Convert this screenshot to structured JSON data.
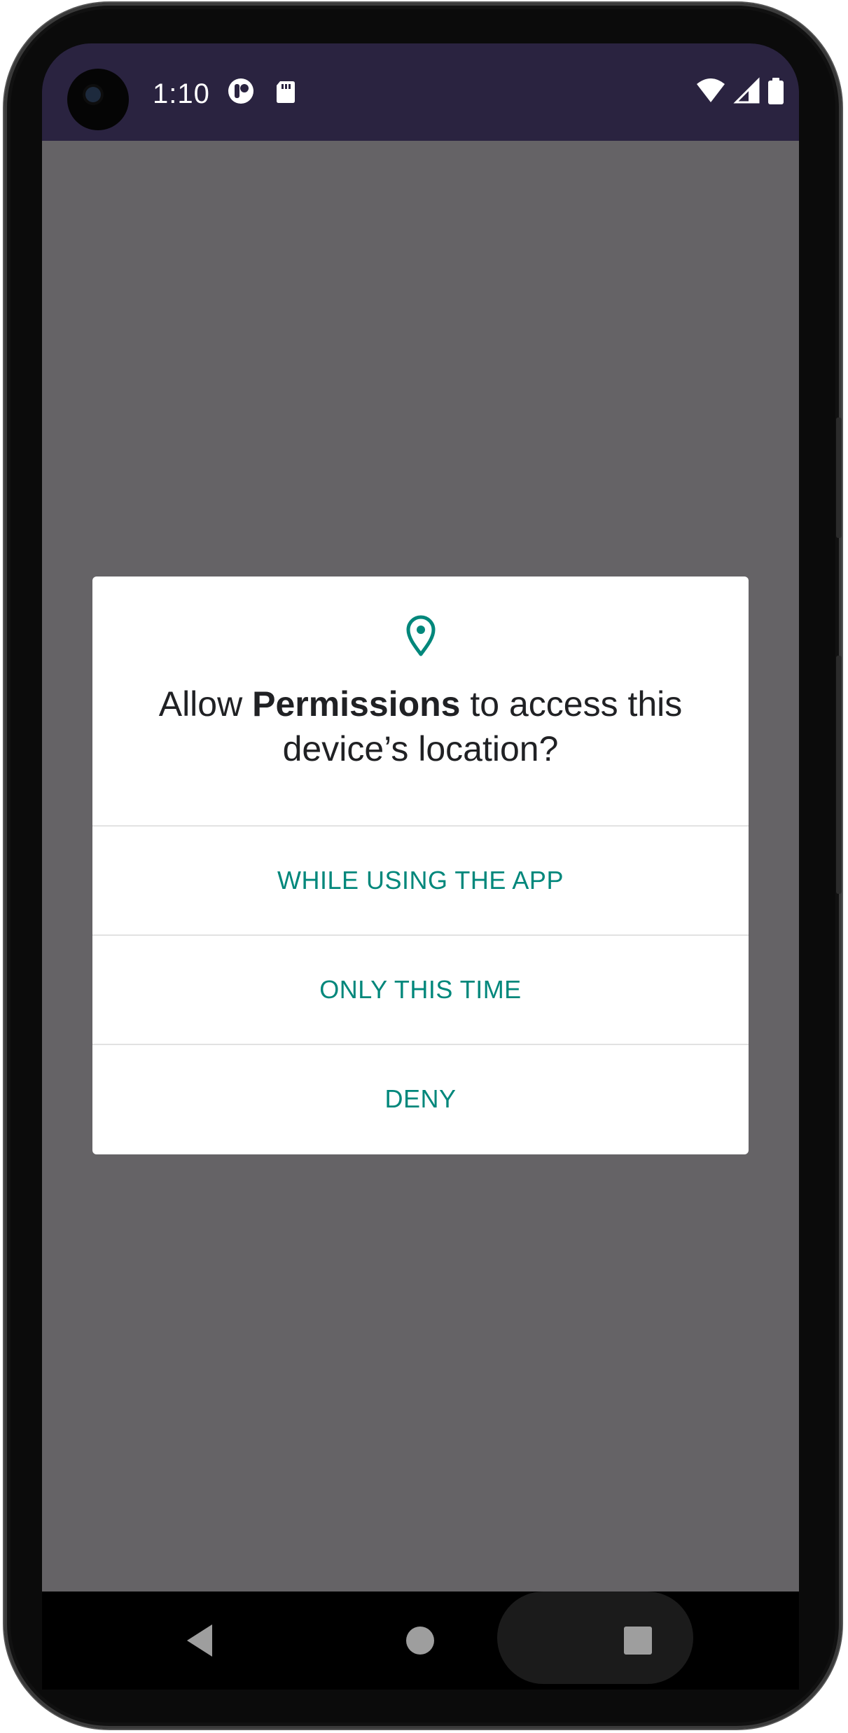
{
  "status_bar": {
    "time": "1:10",
    "icons": [
      "camera-cutout",
      "app-notification-icon",
      "sd-card-icon",
      "wifi-icon",
      "cellular-signal-icon",
      "battery-icon"
    ]
  },
  "dialog": {
    "icon": "location-pin-icon",
    "title_prefix": "Allow ",
    "title_app": "Permissions",
    "title_suffix": " to access this device’s location?",
    "buttons": {
      "while_using": "WHILE USING THE APP",
      "only_this_time": "ONLY THIS TIME",
      "deny": "DENY"
    }
  },
  "nav_bar": {
    "icons": [
      "back-icon",
      "home-icon",
      "recents-icon"
    ]
  },
  "colors": {
    "status_bar": "#2a2340",
    "scrim": "#656366",
    "accent": "#00877b",
    "dialog_bg": "#ffffff",
    "title_text": "#202124"
  }
}
